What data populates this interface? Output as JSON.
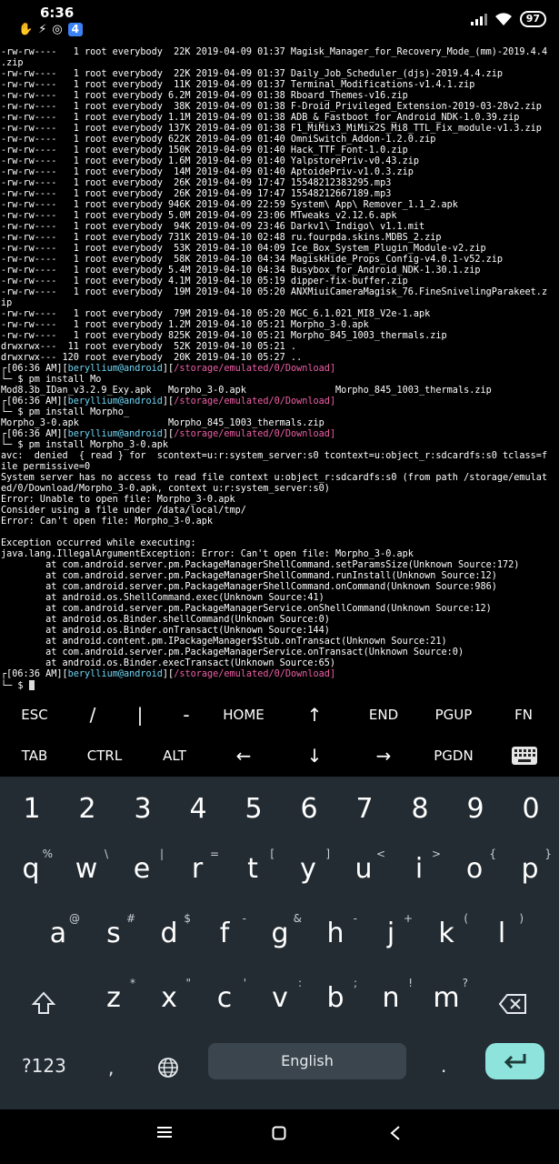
{
  "status_bar": {
    "time": "6:36",
    "battery": "97"
  },
  "terminal": {
    "lines": [
      {
        "t": "out",
        "text": "-rw-rw----   1 root everybody  22K 2019-04-09 01:37 Magisk_Manager_for_Recovery_Mode_(mm)-2019.4.4"
      },
      {
        "t": "out",
        "text": ".zip"
      },
      {
        "t": "out",
        "text": "-rw-rw----   1 root everybody  22K 2019-04-09 01:37 Daily_Job_Scheduler_(djs)-2019.4.4.zip"
      },
      {
        "t": "out",
        "text": "-rw-rw----   1 root everybody  11K 2019-04-09 01:37 Terminal_Modifications-v1.4.1.zip"
      },
      {
        "t": "out",
        "text": "-rw-rw----   1 root everybody 6.2M 2019-04-09 01:38 Rboard_Themes-v16.zip"
      },
      {
        "t": "out",
        "text": "-rw-rw----   1 root everybody  38K 2019-04-09 01:38 F-Droid_Privileged_Extension-2019-03-28v2.zip"
      },
      {
        "t": "out",
        "text": "-rw-rw----   1 root everybody 1.1M 2019-04-09 01:38 ADB_&_Fastboot_for_Android_NDK-1.0.39.zip"
      },
      {
        "t": "out",
        "text": "-rw-rw----   1 root everybody 137K 2019-04-09 01:38 F1_MiMix3_MiMix2S_Mi8_TTL_Fix_module-v1.3.zip"
      },
      {
        "t": "out",
        "text": "-rw-rw----   1 root everybody 622K 2019-04-09 01:40 OmniSwitch_Addon-1.2.0.zip"
      },
      {
        "t": "out",
        "text": "-rw-rw----   1 root everybody 150K 2019-04-09 01:40 Hack_TTF_Font-1.0.zip"
      },
      {
        "t": "out",
        "text": "-rw-rw----   1 root everybody 1.6M 2019-04-09 01:40 YalpstorePriv-v0.43.zip"
      },
      {
        "t": "out",
        "text": "-rw-rw----   1 root everybody  14M 2019-04-09 01:40 AptoidePriv-v1.0.3.zip"
      },
      {
        "t": "out",
        "text": "-rw-rw----   1 root everybody  26K 2019-04-09 17:47 15548212383295.mp3"
      },
      {
        "t": "out",
        "text": "-rw-rw----   1 root everybody  26K 2019-04-09 17:47 15548212667189.mp3"
      },
      {
        "t": "out",
        "text": "-rw-rw----   1 root everybody 946K 2019-04-09 22:59 System\\ App\\ Remover_1.1_2.apk"
      },
      {
        "t": "out",
        "text": "-rw-rw----   1 root everybody 5.0M 2019-04-09 23:06 MTweaks_v2.12.6.apk"
      },
      {
        "t": "out",
        "text": "-rw-rw----   1 root everybody  94K 2019-04-09 23:46 Darkv1\\ Indigo\\ v1.1.mit"
      },
      {
        "t": "out",
        "text": "-rw-rw----   1 root everybody 731K 2019-04-10 02:48 ru.fourpda.skins.MDBS_2.zip"
      },
      {
        "t": "out",
        "text": "-rw-rw----   1 root everybody  53K 2019-04-10 04:09 Ice_Box_System_Plugin_Module-v2.zip"
      },
      {
        "t": "out",
        "text": "-rw-rw----   1 root everybody  58K 2019-04-10 04:34 MagiskHide_Props_Config-v4.0.1-v52.zip"
      },
      {
        "t": "out",
        "text": "-rw-rw----   1 root everybody 5.4M 2019-04-10 04:34 Busybox_for_Android_NDK-1.30.1.zip"
      },
      {
        "t": "out",
        "text": "-rw-rw----   1 root everybody 4.1M 2019-04-10 05:19 dipper-fix-buffer.zip"
      },
      {
        "t": "out",
        "text": "-rw-rw----   1 root everybody  19M 2019-04-10 05:20 ANXMiuiCameraMagisk_76.FineSnivelingParakeet.z"
      },
      {
        "t": "out",
        "text": "ip"
      },
      {
        "t": "out",
        "text": "-rw-rw----   1 root everybody  79M 2019-04-10 05:20 MGC_6.1.021_MI8_V2e-1.apk"
      },
      {
        "t": "out",
        "text": "-rw-rw----   1 root everybody 1.2M 2019-04-10 05:21 Morpho_3-0.apk"
      },
      {
        "t": "out",
        "text": "-rw-rw----   1 root everybody 825K 2019-04-10 05:21 Morpho_845_1003_thermals.zip"
      },
      {
        "t": "out",
        "text": "drwxrwx---  11 root everybody  52K 2019-04-10 05:21 ."
      },
      {
        "t": "out",
        "text": "drwxrwx--- 120 root everybody  20K 2019-04-10 05:27 .."
      },
      {
        "t": "prompt",
        "time": "06:36 AM",
        "user": "beryllium@android",
        "path": "/storage/emulated/0/Download"
      },
      {
        "t": "cmd",
        "text": "pm install Mo"
      },
      {
        "t": "out",
        "text": "Mod8.3b_IDan_v3.2.9_Exy.apk   Morpho_3-0.apk                Morpho_845_1003_thermals.zip"
      },
      {
        "t": "prompt",
        "time": "06:36 AM",
        "user": "beryllium@android",
        "path": "/storage/emulated/0/Download"
      },
      {
        "t": "cmd",
        "text": "pm install Morpho_"
      },
      {
        "t": "out",
        "text": "Morpho_3-0.apk                Morpho_845_1003_thermals.zip"
      },
      {
        "t": "prompt",
        "time": "06:36 AM",
        "user": "beryllium@android",
        "path": "/storage/emulated/0/Download"
      },
      {
        "t": "cmd",
        "text": "pm install Morpho_3-0.apk"
      },
      {
        "t": "out",
        "text": "avc:  denied  { read } for  scontext=u:r:system_server:s0 tcontext=u:object_r:sdcardfs:s0 tclass=f"
      },
      {
        "t": "out",
        "text": "ile permissive=0"
      },
      {
        "t": "out",
        "text": "System server has no access to read file context u:object_r:sdcardfs:s0 (from path /storage/emulat"
      },
      {
        "t": "out",
        "text": "ed/0/Download/Morpho_3-0.apk, context u:r:system_server:s0)"
      },
      {
        "t": "out",
        "text": "Error: Unable to open file: Morpho_3-0.apk"
      },
      {
        "t": "out",
        "text": "Consider using a file under /data/local/tmp/"
      },
      {
        "t": "out",
        "text": "Error: Can't open file: Morpho_3-0.apk"
      },
      {
        "t": "out",
        "text": ""
      },
      {
        "t": "out",
        "text": "Exception occurred while executing:"
      },
      {
        "t": "out",
        "text": "java.lang.IllegalArgumentException: Error: Can't open file: Morpho_3-0.apk"
      },
      {
        "t": "out",
        "text": "        at com.android.server.pm.PackageManagerShellCommand.setParamsSize(Unknown Source:172)"
      },
      {
        "t": "out",
        "text": "        at com.android.server.pm.PackageManagerShellCommand.runInstall(Unknown Source:12)"
      },
      {
        "t": "out",
        "text": "        at com.android.server.pm.PackageManagerShellCommand.onCommand(Unknown Source:986)"
      },
      {
        "t": "out",
        "text": "        at android.os.ShellCommand.exec(Unknown Source:41)"
      },
      {
        "t": "out",
        "text": "        at com.android.server.pm.PackageManagerService.onShellCommand(Unknown Source:12)"
      },
      {
        "t": "out",
        "text": "        at android.os.Binder.shellCommand(Unknown Source:0)"
      },
      {
        "t": "out",
        "text": "        at android.os.Binder.onTransact(Unknown Source:144)"
      },
      {
        "t": "out",
        "text": "        at android.content.pm.IPackageManager$Stub.onTransact(Unknown Source:21)"
      },
      {
        "t": "out",
        "text": "        at com.android.server.pm.PackageManagerService.onTransact(Unknown Source:0)"
      },
      {
        "t": "out",
        "text": "        at android.os.Binder.execTransact(Unknown Source:65)"
      },
      {
        "t": "prompt",
        "time": "06:36 AM",
        "user": "beryllium@android",
        "path": "/storage/emulated/0/Download"
      },
      {
        "t": "cmd",
        "text": "",
        "cursor": true
      }
    ]
  },
  "extra_keys": {
    "row1": [
      "ESC",
      "/",
      "|",
      "-",
      "HOME",
      "↑",
      "END",
      "PGUP",
      "FN"
    ],
    "row2": [
      "TAB",
      "CTRL",
      "ALT",
      "←",
      "↓",
      "→",
      "PGDN"
    ]
  },
  "keyboard": {
    "numbers": [
      "1",
      "2",
      "3",
      "4",
      "5",
      "6",
      "7",
      "8",
      "9",
      "0"
    ],
    "row1": [
      {
        "k": "q",
        "h": "%"
      },
      {
        "k": "w",
        "h": "\\"
      },
      {
        "k": "e",
        "h": "|"
      },
      {
        "k": "r",
        "h": "="
      },
      {
        "k": "t",
        "h": "["
      },
      {
        "k": "y",
        "h": "]"
      },
      {
        "k": "u",
        "h": "<"
      },
      {
        "k": "i",
        "h": ">"
      },
      {
        "k": "o",
        "h": "{"
      },
      {
        "k": "p",
        "h": "}"
      }
    ],
    "row2": [
      {
        "k": "a",
        "h": "@"
      },
      {
        "k": "s",
        "h": "#"
      },
      {
        "k": "d",
        "h": "$"
      },
      {
        "k": "f",
        "h": "-"
      },
      {
        "k": "g",
        "h": "&"
      },
      {
        "k": "h",
        "h": "-"
      },
      {
        "k": "j",
        "h": "+"
      },
      {
        "k": "k",
        "h": "("
      },
      {
        "k": "l",
        "h": ")"
      }
    ],
    "row3": [
      {
        "k": "z",
        "h": "*"
      },
      {
        "k": "x",
        "h": "\""
      },
      {
        "k": "c",
        "h": "'"
      },
      {
        "k": "v",
        "h": ":"
      },
      {
        "k": "b",
        "h": ";"
      },
      {
        "k": "n",
        "h": "!"
      },
      {
        "k": "m",
        "h": "?"
      }
    ],
    "symbols_label": "?123",
    "comma": ",",
    "space_label": "English",
    "period": "."
  }
}
